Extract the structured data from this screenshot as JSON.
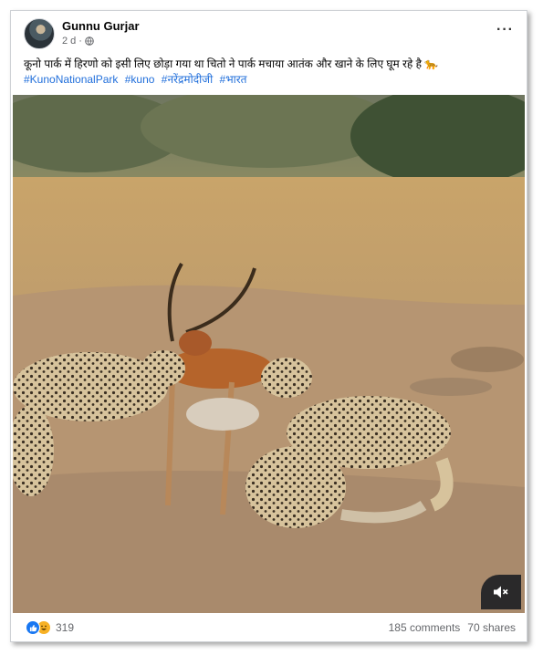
{
  "post": {
    "author": "Gunnu Gurjar",
    "time": "2 d",
    "separator": "·",
    "caption": "कूनो पार्क में हिरणो को इसी लिए छोड़ा गया था चितो ने पार्क मचाया आतंक और खाने के लिए घूम रहे है 🐆",
    "hashtags": [
      "#KunoNationalPark",
      "#kuno",
      "#नरेंद्रमोदीजी",
      "#भारत"
    ],
    "more_label": "···"
  },
  "footer": {
    "reaction_count": "319",
    "comments": "185 comments",
    "shares": "70 shares"
  },
  "colors": {
    "link": "#216fdb",
    "like_blue": "#1877f2",
    "secondary_text": "#65676b"
  },
  "icons": {
    "privacy": "globe-icon",
    "menu": "more-options-icon",
    "sound": "speaker-muted-icon",
    "reactions": [
      "like-icon",
      "haha-icon"
    ]
  }
}
